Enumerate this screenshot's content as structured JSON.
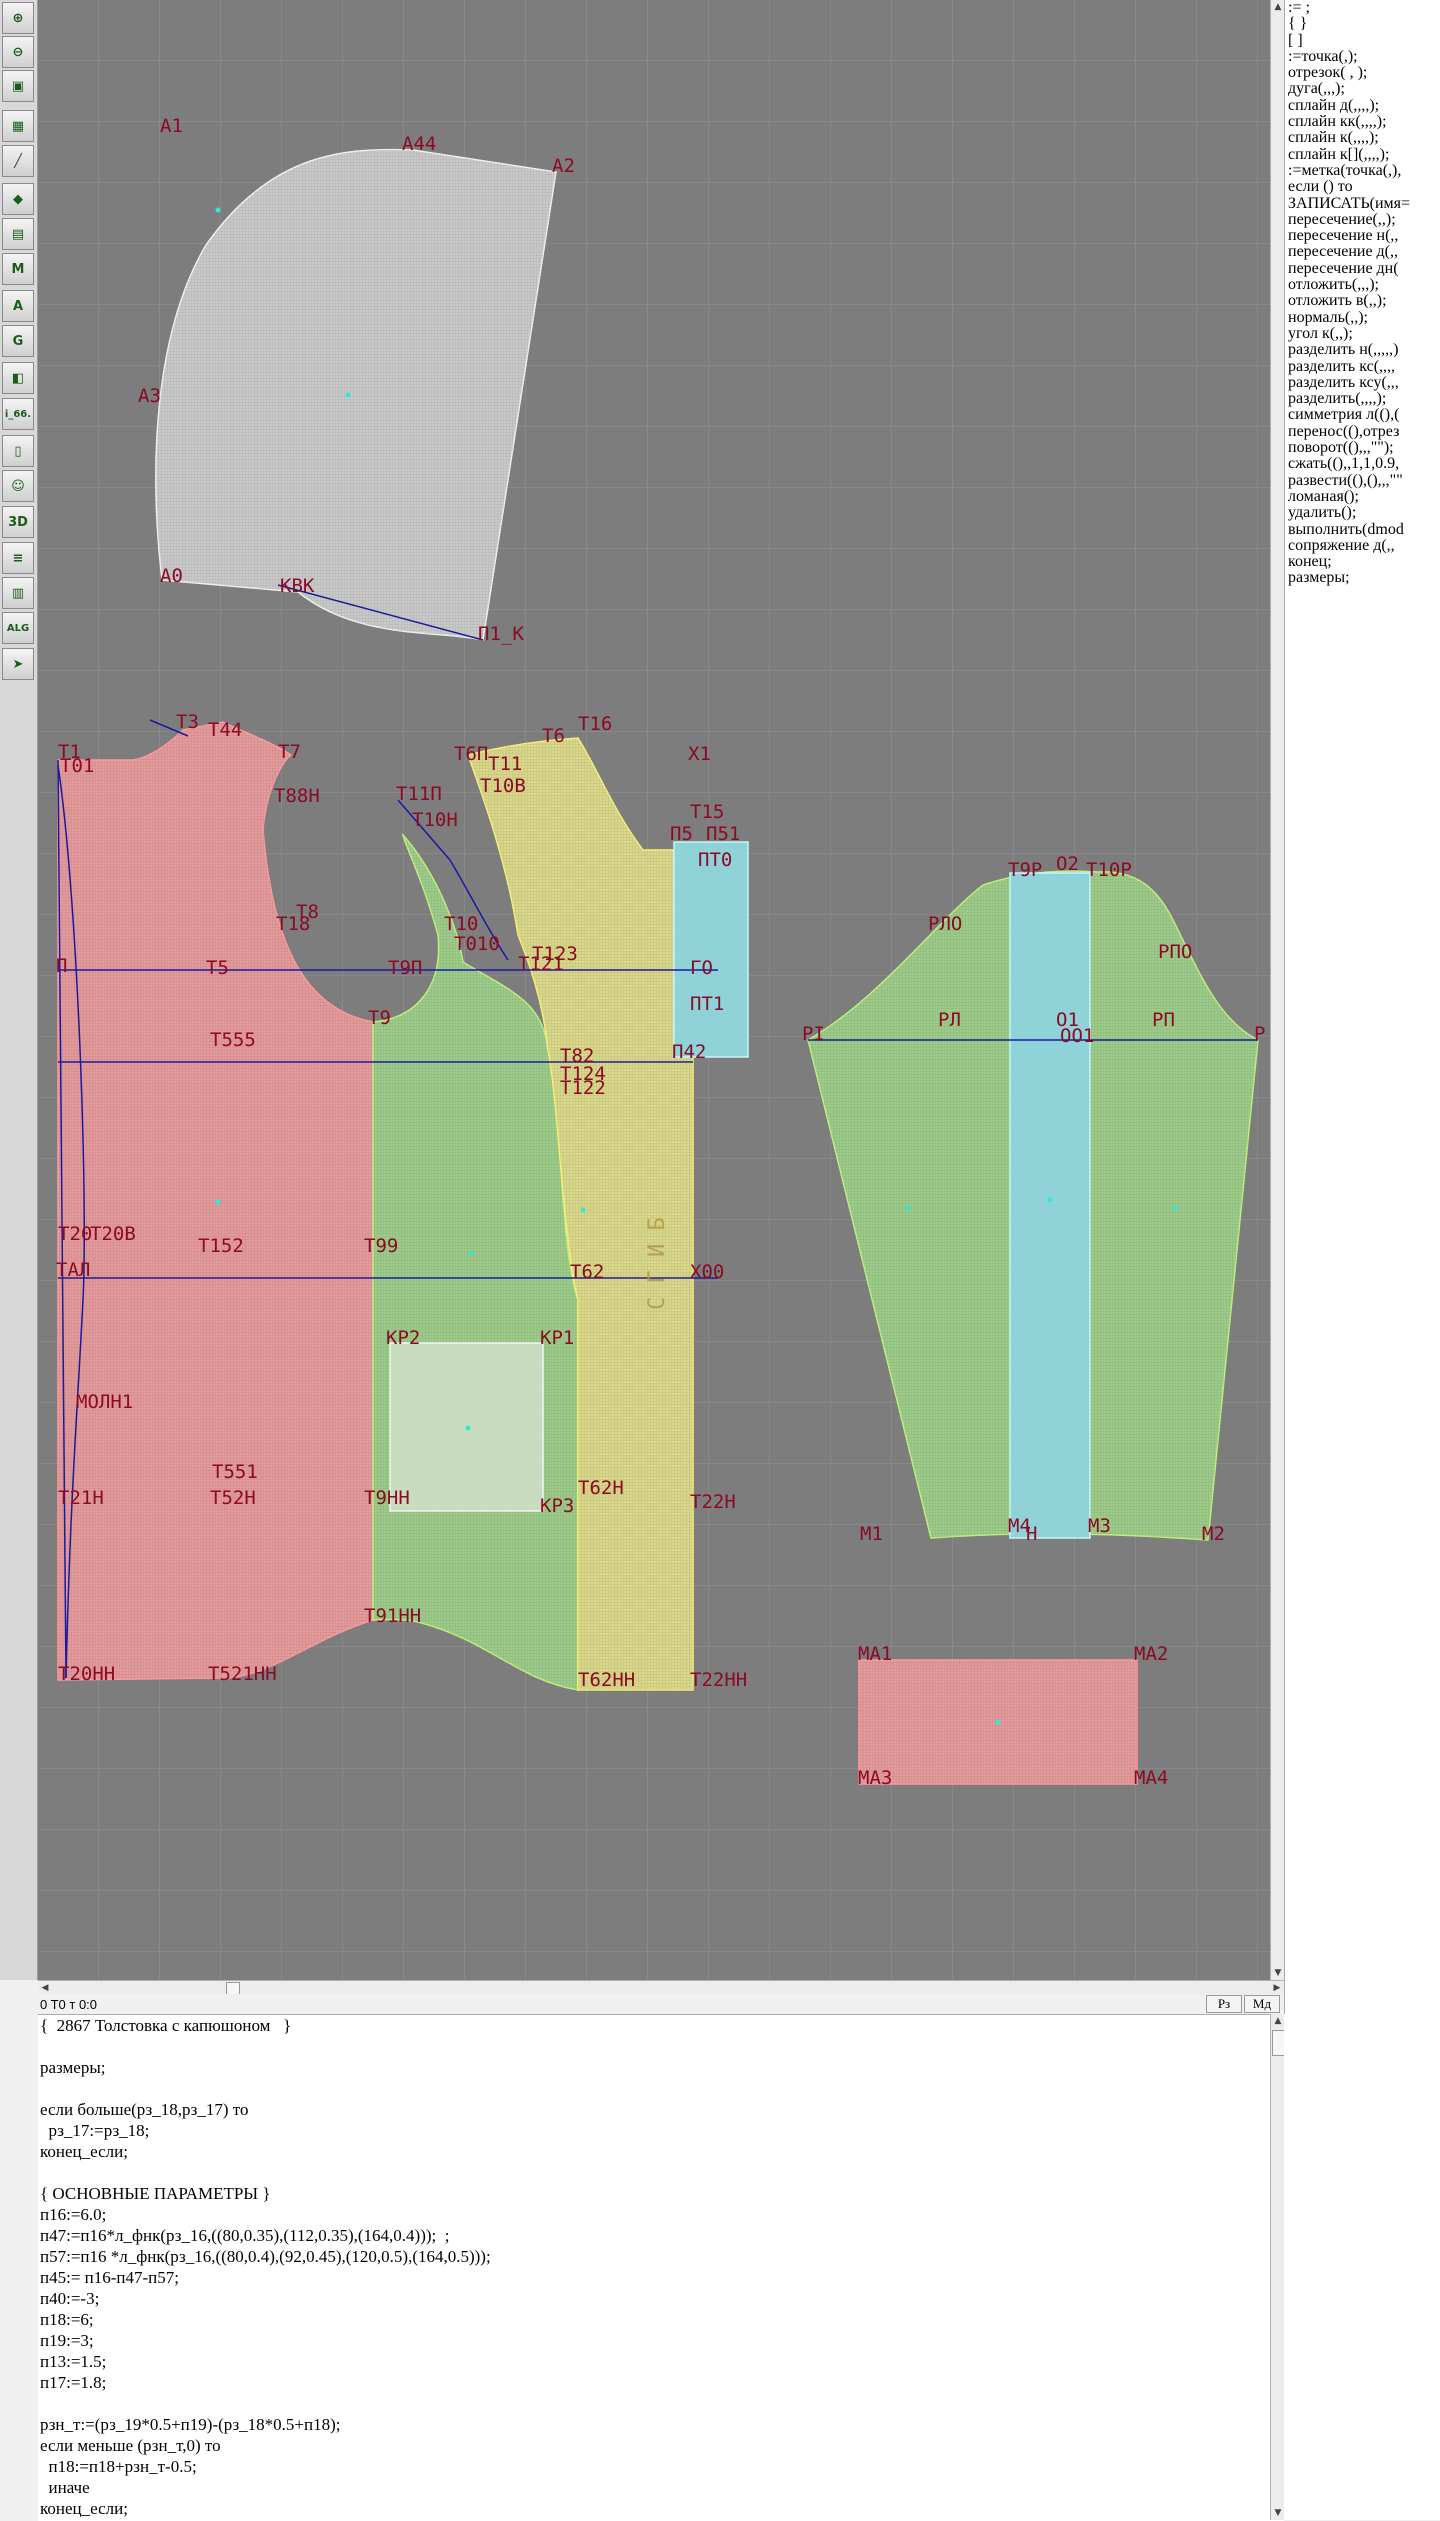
{
  "window": {
    "title": "2867 Толстовка с капюшоном"
  },
  "toolbar": {
    "tools": [
      {
        "name": "add-icon",
        "glyph": "⊕"
      },
      {
        "name": "zoom-icon",
        "glyph": "⊖"
      },
      {
        "name": "pattern-icon",
        "glyph": "▣"
      },
      {
        "name": "grid-icon",
        "glyph": "▦"
      },
      {
        "name": "line-icon",
        "glyph": "╱"
      },
      {
        "name": "layer-icon",
        "glyph": "◆"
      },
      {
        "name": "measure-icon",
        "glyph": "▤"
      },
      {
        "name": "m-icon",
        "glyph": "M"
      },
      {
        "name": "a-icon",
        "glyph": "A"
      },
      {
        "name": "g-icon",
        "glyph": "G"
      },
      {
        "name": "sheet-icon",
        "glyph": "◧"
      },
      {
        "name": "i66-icon",
        "glyph": "i_66."
      },
      {
        "name": "document-icon",
        "glyph": "▯"
      },
      {
        "name": "person-icon",
        "glyph": "☺"
      },
      {
        "name": "3d-icon",
        "glyph": "3D"
      },
      {
        "name": "text-icon",
        "glyph": "≡"
      },
      {
        "name": "stack-icon",
        "glyph": "▥"
      },
      {
        "name": "alg-icon",
        "glyph": "ALG"
      },
      {
        "name": "exit-icon",
        "glyph": "➤"
      }
    ]
  },
  "status": {
    "text": "0  T0 т 0:0",
    "btn_rz": "Рз",
    "btn_md": "Мд"
  },
  "command_list": [
    ":= ;",
    "{  }",
    "[  ]",
    ":=точка(,);",
    "отрезок( , );",
    "дуга(,,,);",
    "сплайн  д(,,,,);",
    "сплайн  кк(,,,,);",
    "сплайн  к(,,,,);",
    "сплайн  к[](,,,,);",
    ":=метка(точка(,),",
    "если () то",
    "ЗАПИСАТЬ(имя=",
    "пересечение(,,);",
    "пересечение  н(,,",
    "пересечение  д(,,",
    "пересечение  дн(",
    "отложить(,,,);",
    "отложить  в(,,);",
    "нормаль(,,);",
    "угол  к(,,);",
    "разделить  н(,,,,,)",
    "разделить  кс(,,,,",
    "разделить  ксу(,,,",
    "разделить(,,,,);",
    "симметрия  л((),(",
    "перенос((),отрез",
    "поворот((),,,\"\");",
    "сжать((),,1,1,0.9,",
    "развести((),(),,,\"\"",
    "ломаная();",
    "удалить();",
    "выполнить(dmod",
    "сопряжение  д(,,",
    "конец;",
    "размеры;"
  ],
  "code_lines": [
    "{  2867 Толстовка с капюшоном   }",
    "",
    "размеры;",
    "",
    "если больше(рз_18,рз_17) то",
    "  рз_17:=рз_18;",
    "конец_если;",
    "",
    "{ ОСНОВНЫЕ ПАРАМЕТРЫ }",
    "п16:=6.0;",
    "п47:=п16*л_фнк(рз_16,((80,0.35),(112,0.35),(164,0.4)));  ;",
    "п57:=п16 *л_фнк(рз_16,((80,0.4),(92,0.45),(120,0.5),(164,0.5)));",
    "п45:= п16-п47-п57;",
    "п40:=-3;",
    "п18:=6;",
    "п19:=3;",
    "п13:=1.5;",
    "п17:=1.8;",
    "",
    "рзн_т:=(рз_19*0.5+п19)-(рз_18*0.5+п18);",
    "если меньше (рзн_т,0) то",
    "  п18:=п18+рзн_т-0.5;",
    "  иначе",
    "конец_если;"
  ],
  "canvas": {
    "colors": {
      "background": "#7d7d7d",
      "grid": "#9a9a9a",
      "hood": "#c9c9c9",
      "back": "#e49a9a",
      "front": "#9dcc8a",
      "placket": "#d9d78a",
      "band": "#8fd3d8",
      "label": "#8b0a24",
      "construction": "#1a1aa0",
      "point": "#31e8d4"
    },
    "labels": [
      {
        "text": "A1"
      },
      {
        "text": "A44"
      },
      {
        "text": "A2"
      },
      {
        "text": "A3"
      },
      {
        "text": "A0"
      },
      {
        "text": "KBK"
      },
      {
        "text": "П1_К"
      },
      {
        "text": "T3"
      },
      {
        "text": "T44"
      },
      {
        "text": "T1"
      },
      {
        "text": "T01"
      },
      {
        "text": "T7"
      },
      {
        "text": "T88H"
      },
      {
        "text": "T8"
      },
      {
        "text": "T18"
      },
      {
        "text": "П"
      },
      {
        "text": "T5"
      },
      {
        "text": "T9П"
      },
      {
        "text": "T9"
      },
      {
        "text": "T555"
      },
      {
        "text": "T20"
      },
      {
        "text": "T20B"
      },
      {
        "text": "T152"
      },
      {
        "text": "T99"
      },
      {
        "text": "TAЛ"
      },
      {
        "text": "MOЛH1"
      },
      {
        "text": "T551"
      },
      {
        "text": "T21H"
      },
      {
        "text": "T52H"
      },
      {
        "text": "T9HH"
      },
      {
        "text": "T20HH"
      },
      {
        "text": "T521HH"
      },
      {
        "text": "T11П"
      },
      {
        "text": "T10H"
      },
      {
        "text": "T10"
      },
      {
        "text": "T010"
      },
      {
        "text": "T121"
      },
      {
        "text": "T123"
      },
      {
        "text": "T6П"
      },
      {
        "text": "T11"
      },
      {
        "text": "T6"
      },
      {
        "text": "T16"
      },
      {
        "text": "T10B"
      },
      {
        "text": "X1"
      },
      {
        "text": "T15"
      },
      {
        "text": "П5"
      },
      {
        "text": "П51"
      },
      {
        "text": "ПT0"
      },
      {
        "text": "ГО"
      },
      {
        "text": "ПT1"
      },
      {
        "text": "П42"
      },
      {
        "text": "T82"
      },
      {
        "text": "T124"
      },
      {
        "text": "T122"
      },
      {
        "text": "T62"
      },
      {
        "text": "X00"
      },
      {
        "text": "KP2"
      },
      {
        "text": "KP1"
      },
      {
        "text": "KP3"
      },
      {
        "text": "T62H"
      },
      {
        "text": "T22H"
      },
      {
        "text": "T62HH"
      },
      {
        "text": "T22HH"
      },
      {
        "text": "T91HH"
      },
      {
        "text": "C Г И Б"
      },
      {
        "text": "T9P"
      },
      {
        "text": "O2"
      },
      {
        "text": "T10P"
      },
      {
        "text": "PЛO"
      },
      {
        "text": "PПO"
      },
      {
        "text": "PЛ"
      },
      {
        "text": "PП"
      },
      {
        "text": "PI"
      },
      {
        "text": "P"
      },
      {
        "text": "O1"
      },
      {
        "text": "OO1"
      },
      {
        "text": "M1"
      },
      {
        "text": "M4"
      },
      {
        "text": "M3"
      },
      {
        "text": "M2"
      },
      {
        "text": "H"
      },
      {
        "text": "MA1"
      },
      {
        "text": "MA2"
      },
      {
        "text": "MA3"
      },
      {
        "text": "MA4"
      }
    ]
  }
}
